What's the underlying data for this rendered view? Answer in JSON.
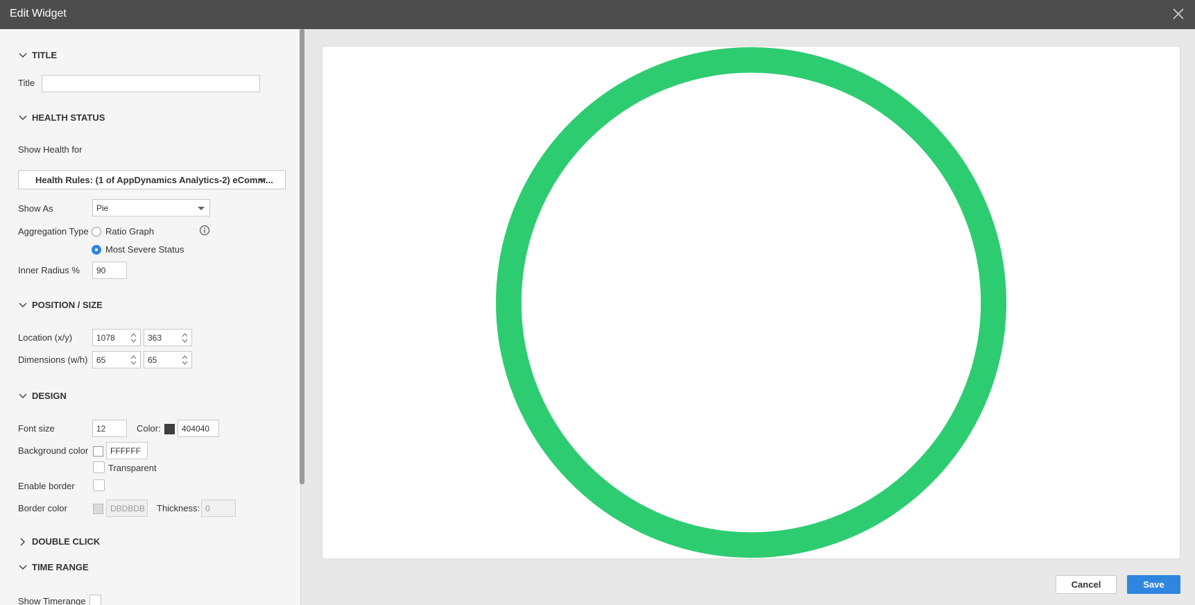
{
  "window": {
    "title": "Edit Widget",
    "close_icon": "close-icon"
  },
  "sections": {
    "title": "TITLE",
    "health_status": "HEALTH STATUS",
    "position_size": "POSITION / SIZE",
    "design": "DESIGN",
    "double_click": "DOUBLE CLICK",
    "time_range": "TIME RANGE"
  },
  "title_section": {
    "label": "Title",
    "value": ""
  },
  "health": {
    "show_health_for_label": "Show Health for",
    "show_health_for_value": "Health Rules: (1 of AppDynamics Analytics-2) eComm...",
    "show_as_label": "Show As",
    "show_as_value": "Pie",
    "aggregation_label": "Aggregation Type",
    "aggregation_options": [
      "Ratio Graph",
      "Most Severe Status"
    ],
    "aggregation_selected": "Most Severe Status",
    "inner_radius_label": "Inner Radius %",
    "inner_radius_value": "90"
  },
  "position": {
    "location_label": "Location (x/y)",
    "location_x": "1078",
    "location_y": "363",
    "dimensions_label": "Dimensions (w/h)",
    "width": "65",
    "height": "65"
  },
  "design": {
    "font_size_label": "Font size",
    "font_size_value": "12",
    "color_label": "Color:",
    "color_value": "404040",
    "color_hex": "#404040",
    "bg_label": "Background color",
    "bg_value": "FFFFFF",
    "transparent_label": "Transparent",
    "enable_border_label": "Enable border",
    "border_color_label": "Border color",
    "border_color_value": "DBDBDB",
    "thickness_label": "Thickness:",
    "thickness_value": "0"
  },
  "time_range": {
    "show_timerange_label": "Show Timerange"
  },
  "preview": {
    "ring_color": "#2ecc71",
    "inner_radius_percent": 90
  },
  "buttons": {
    "cancel": "Cancel",
    "save": "Save"
  }
}
